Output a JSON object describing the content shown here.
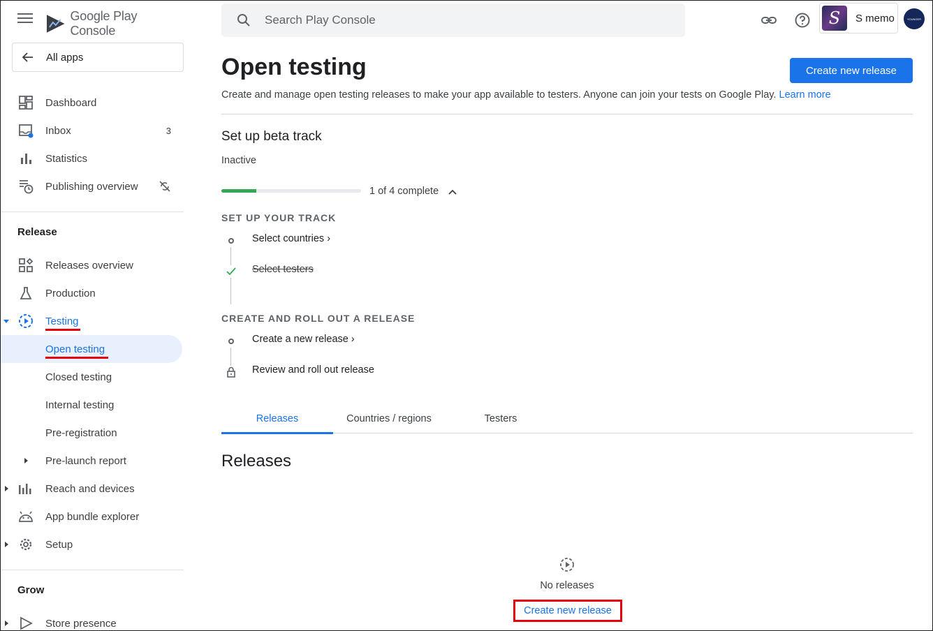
{
  "brand": {
    "name": "Google Play Console"
  },
  "search": {
    "placeholder": "Search Play Console"
  },
  "account": {
    "app_name": "S memo",
    "dev_badge": "YOUNGER"
  },
  "sidebar": {
    "all_apps": "All apps",
    "main_items": [
      {
        "label": "Dashboard",
        "icon": "dashboard-icon"
      },
      {
        "label": "Inbox",
        "icon": "inbox-icon",
        "count": "3"
      },
      {
        "label": "Statistics",
        "icon": "bar-chart-icon"
      },
      {
        "label": "Publishing overview",
        "icon": "publishing-icon"
      }
    ],
    "release_header": "Release",
    "release_items": [
      {
        "label": "Releases overview",
        "icon": "releases-overview-icon"
      },
      {
        "label": "Production",
        "icon": "production-icon"
      },
      {
        "label": "Testing",
        "icon": "testing-icon"
      },
      {
        "label": "Open testing"
      },
      {
        "label": "Closed testing"
      },
      {
        "label": "Internal testing"
      },
      {
        "label": "Pre-registration"
      },
      {
        "label": "Pre-launch report"
      },
      {
        "label": "Reach and devices",
        "icon": "reach-devices-icon"
      },
      {
        "label": "App bundle explorer",
        "icon": "android-icon"
      },
      {
        "label": "Setup",
        "icon": "gear-icon"
      }
    ],
    "grow_header": "Grow",
    "grow_items": [
      {
        "label": "Store presence",
        "icon": "store-presence-icon"
      }
    ]
  },
  "main": {
    "title": "Open testing",
    "create_button": "Create new release",
    "description": "Create and manage open testing releases to make your app available to testers. Anyone can join your tests on Google Play.",
    "learn_more": "Learn more",
    "setup_title": "Set up beta track",
    "status": "Inactive",
    "progress_fraction": 0.25,
    "progress_text": "1 of 4 complete",
    "track_section": "SET UP YOUR TRACK",
    "track_steps": [
      {
        "label": "Select countries",
        "done": false
      },
      {
        "label": "Select testers",
        "done": true
      }
    ],
    "release_section": "CREATE AND ROLL OUT A RELEASE",
    "release_steps": [
      {
        "label": "Create a new release",
        "locked": false
      },
      {
        "label": "Review and roll out release",
        "locked": true
      }
    ],
    "tabs": [
      "Releases",
      "Countries / regions",
      "Testers"
    ],
    "active_tab": "Releases",
    "releases_heading": "Releases",
    "empty_text": "No releases",
    "empty_link": "Create new release"
  },
  "colors": {
    "accent": "#1a73e8",
    "progress": "#34a853",
    "highlight": "#e8000d"
  }
}
